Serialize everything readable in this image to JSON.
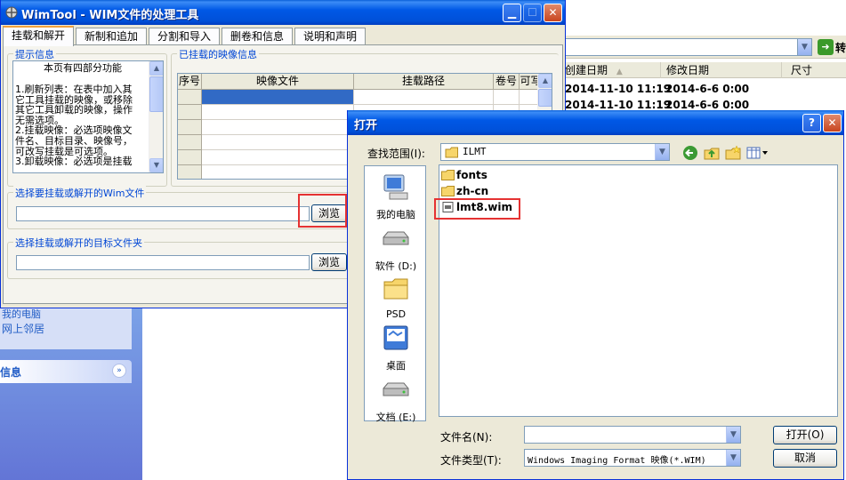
{
  "explorer": {
    "go_label": "转",
    "columns": [
      "创建日期",
      "修改日期",
      "尺寸"
    ],
    "rows": [
      {
        "created": "2014-11-10 11:19",
        "modified": "2014-6-6 0:00"
      },
      {
        "created": "2014-11-10 11:19",
        "modified": "2014-6-6 0:00"
      }
    ],
    "left_panel": {
      "partial_item": "我的电脑",
      "network_item": "网上邻居",
      "details_header": "信息"
    }
  },
  "wimtool": {
    "title": "WimTool - WIM文件的处理工具",
    "tabs": [
      "挂载和解开",
      "新制和追加",
      "分割和导入",
      "删卷和信息",
      "说明和声明"
    ],
    "tips": {
      "legend": "提示信息",
      "heading": "本页有四部分功能",
      "lines": [
        "1.刷新列表：在表中加入其",
        "它工具挂载的映像，或移除",
        "其它工具卸载的映像，操作",
        "无需选项。",
        "2.挂载映像：必选项映像文",
        "件名、目标目录、映像号，",
        "可改写挂载是可选项。",
        "3.卸载映像：必选项是挂载"
      ]
    },
    "mounted": {
      "legend": "已挂载的映像信息",
      "headers": [
        "序号",
        "映像文件",
        "挂载路径",
        "卷号",
        "可写"
      ]
    },
    "select_wim": {
      "legend": "选择要挂载或解开的Wim文件",
      "value": "",
      "browse": "浏览"
    },
    "select_target": {
      "legend": "选择挂载或解开的目标文件夹",
      "value": "",
      "browse": "浏览"
    }
  },
  "open_dialog": {
    "title": "打开",
    "look_in_label": "查找范围(I):",
    "look_in_value": "ILMT",
    "places": [
      {
        "label": "我的电脑",
        "icon": "my-computer-icon"
      },
      {
        "label": "软件 (D:)",
        "icon": "drive-icon"
      },
      {
        "label": "PSD",
        "icon": "folder-icon"
      },
      {
        "label": "桌面",
        "icon": "desktop-icon"
      },
      {
        "label": "文档 (E:)",
        "icon": "drive-icon"
      }
    ],
    "files": [
      {
        "name": "fonts",
        "icon": "folder-icon"
      },
      {
        "name": "zh-cn",
        "icon": "folder-icon"
      },
      {
        "name": "lmt8.wim",
        "icon": "wim-file-icon"
      }
    ],
    "filename_label": "文件名(N):",
    "filename_value": "",
    "filetype_label": "文件类型(T):",
    "filetype_value": "Windows Imaging Format 映像(*.WIM)",
    "open_button": "打开(O)",
    "cancel_button": "取消"
  },
  "colors": {
    "titlebar": "#0058e6",
    "highlight_box": "#e53232",
    "selection": "#316ac5"
  }
}
